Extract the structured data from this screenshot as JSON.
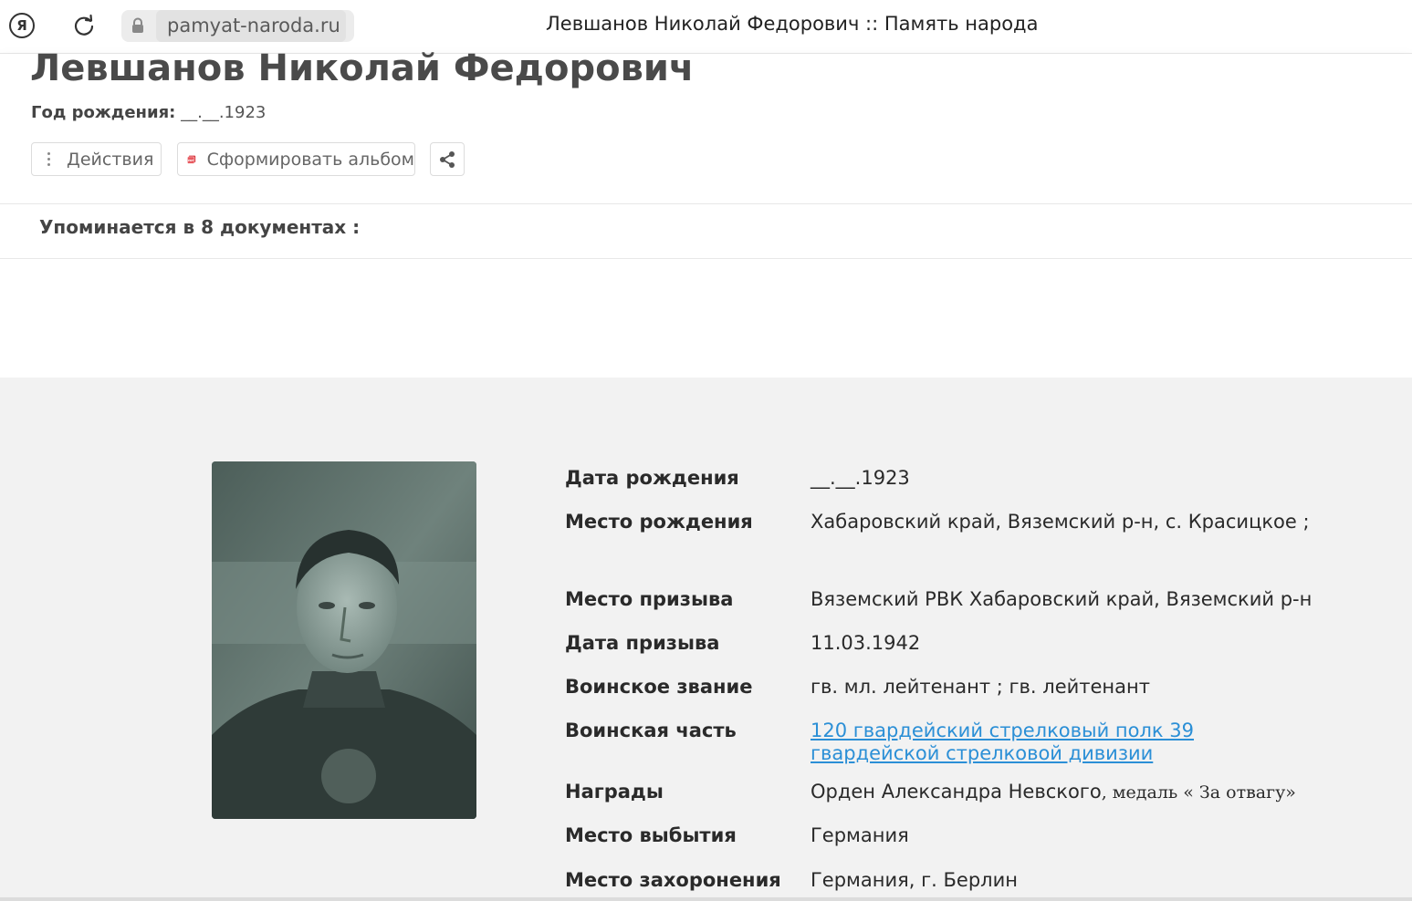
{
  "browser": {
    "yandex_letter": "Я",
    "url": "pamyat-naroda.ru",
    "tab_title": "Левшанов Николай Федорович :: Память народа"
  },
  "header": {
    "name": "Левшанов Николай Федорович",
    "birth_label": "Год рождения:",
    "birth_value": "__.__.1923",
    "actions_label": "Действия",
    "album_label": "Сформировать альбом",
    "mentions": "Упоминается в 8 документах :"
  },
  "details": {
    "rows": [
      {
        "label": "Дата рождения",
        "value": "__.__.1923"
      },
      {
        "label": "Место рождения",
        "value": "Хабаровский край, Вяземский р-н, с. Красицкое ;"
      },
      {
        "label": "Место призыва",
        "value": "Вяземский РВК Хабаровский край, Вяземский р-н"
      },
      {
        "label": "Дата призыва",
        "value": "11.03.1942"
      },
      {
        "label": "Воинское звание",
        "value": "гв. мл. лейтенант ; гв. лейтенант"
      },
      {
        "label": "Воинская часть",
        "value": "120 гвардейский стрелковый полк 39 гвардейской стрелковой дивизии"
      },
      {
        "label": "Награды",
        "value": "Орден Александра Невского",
        "value_extra": ", медаль « За отвагу»"
      },
      {
        "label": "Место выбытия",
        "value": "Германия"
      },
      {
        "label": "Место захоронения",
        "value": "Германия, г. Берлин"
      }
    ]
  },
  "colors": {
    "link": "#2b8fd6",
    "section_bg": "#f2f2f2",
    "pdf_red": "#d9363e"
  }
}
